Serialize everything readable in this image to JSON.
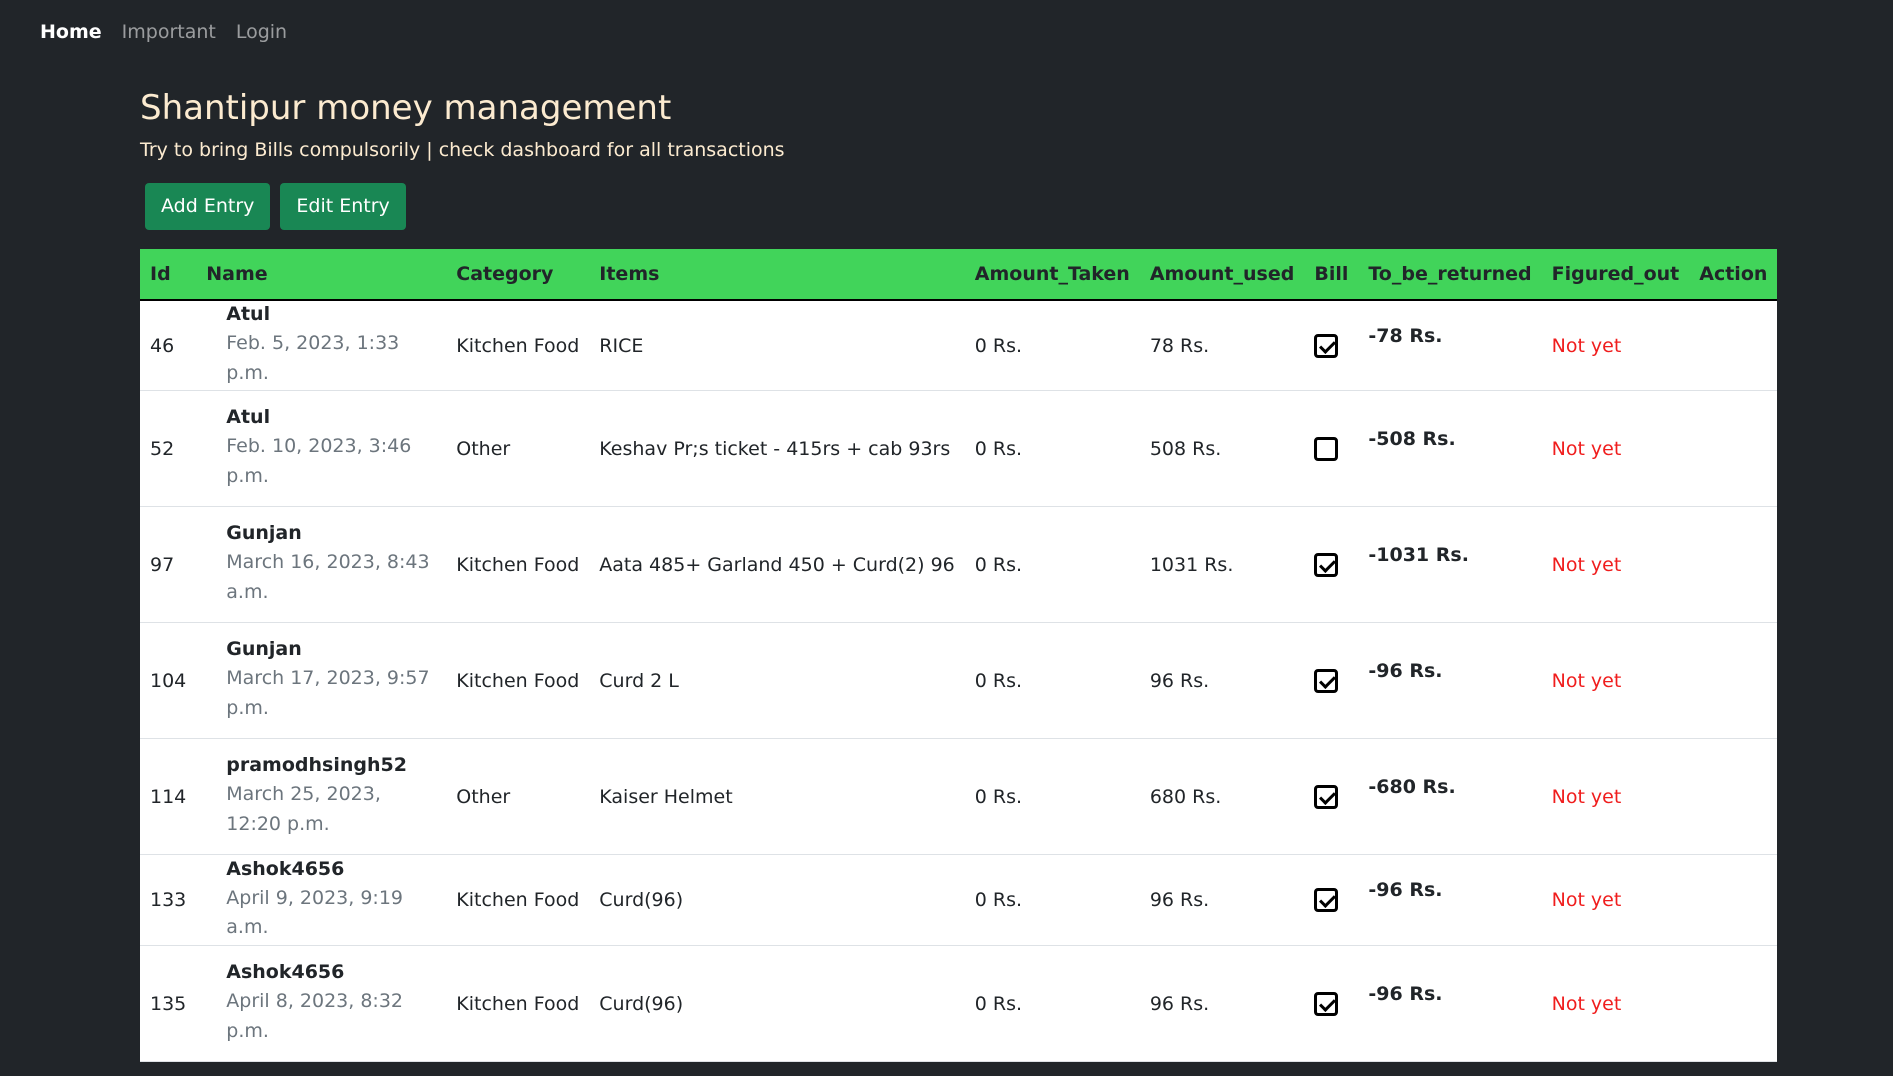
{
  "nav": {
    "home": "Home",
    "important": "Important",
    "login": "Login"
  },
  "header": {
    "title": "Shantipur money management",
    "subtitle": "Try to bring Bills compulsorily | check dashboard for all transactions"
  },
  "buttons": {
    "add": "Add Entry",
    "edit": "Edit Entry"
  },
  "table": {
    "columns": [
      "Id",
      "Name",
      "Category",
      "Items",
      "Amount_Taken",
      "Amount_used",
      "Bill",
      "To_be_returned",
      "Figured_out",
      "Action"
    ],
    "rows": [
      {
        "id": "46",
        "name": "Atul",
        "date": "Feb. 5, 2023, 1:33 p.m.",
        "category": "Kitchen Food",
        "items": "RICE",
        "taken": "0 Rs.",
        "used": "78 Rs.",
        "bill": true,
        "return": "-78 Rs.",
        "status": "Not yet",
        "action": ""
      },
      {
        "id": "52",
        "name": "Atul",
        "date": "Feb. 10, 2023, 3:46 p.m.",
        "category": "Other",
        "items": "Keshav Pr;s ticket - 415rs + cab 93rs",
        "taken": "0 Rs.",
        "used": "508 Rs.",
        "bill": false,
        "return": "-508 Rs.",
        "status": "Not yet",
        "action": ""
      },
      {
        "id": "97",
        "name": "Gunjan",
        "date": "March 16, 2023, 8:43 a.m.",
        "category": "Kitchen Food",
        "items": "Aata 485+ Garland 450 + Curd(2) 96",
        "taken": "0 Rs.",
        "used": "1031 Rs.",
        "bill": true,
        "return": "-1031 Rs.",
        "status": "Not yet",
        "action": ""
      },
      {
        "id": "104",
        "name": "Gunjan",
        "date": "March 17, 2023, 9:57 p.m.",
        "category": "Kitchen Food",
        "items": "Curd 2 L",
        "taken": "0 Rs.",
        "used": "96 Rs.",
        "bill": true,
        "return": "-96 Rs.",
        "status": "Not yet",
        "action": ""
      },
      {
        "id": "114",
        "name": "pramodhsingh52",
        "date": "March 25, 2023, 12:20 p.m.",
        "category": "Other",
        "items": "Kaiser Helmet",
        "taken": "0 Rs.",
        "used": "680 Rs.",
        "bill": true,
        "return": "-680 Rs.",
        "status": "Not yet",
        "action": ""
      },
      {
        "id": "133",
        "name": "Ashok4656",
        "date": "April 9, 2023, 9:19 a.m.",
        "category": "Kitchen Food",
        "items": "Curd(96)",
        "taken": "0 Rs.",
        "used": "96 Rs.",
        "bill": true,
        "return": "-96 Rs.",
        "status": "Not yet",
        "action": ""
      },
      {
        "id": "135",
        "name": "Ashok4656",
        "date": "April 8, 2023, 8:32 p.m.",
        "category": "Kitchen Food",
        "items": "Curd(96)",
        "taken": "0 Rs.",
        "used": "96 Rs.",
        "bill": true,
        "return": "-96 Rs.",
        "status": "Not yet",
        "action": ""
      }
    ]
  }
}
